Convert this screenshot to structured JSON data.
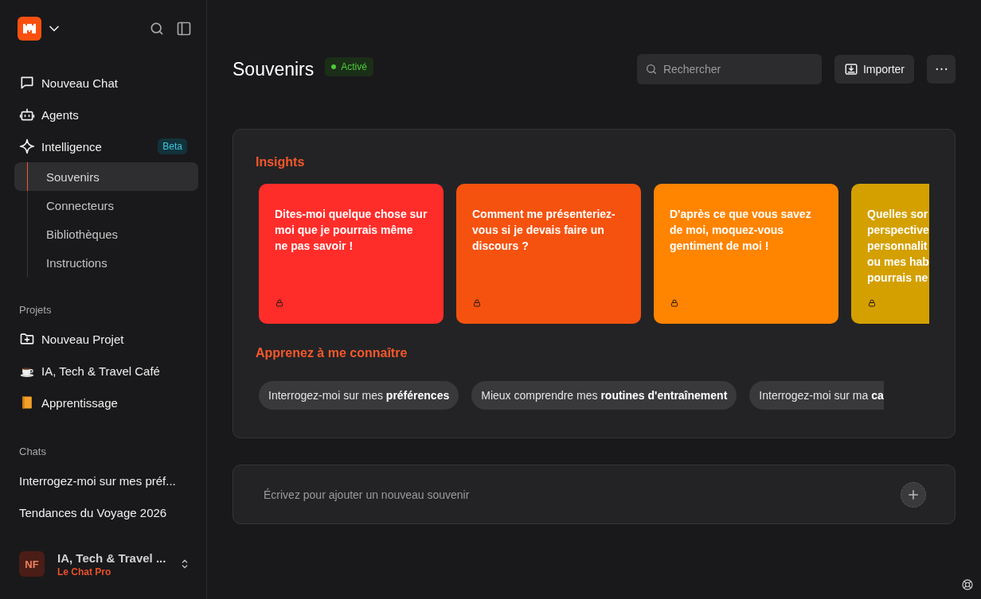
{
  "sidebar": {
    "nav": [
      {
        "label": "Nouveau Chat",
        "kind": "chat"
      },
      {
        "label": "Agents",
        "kind": "robot"
      },
      {
        "label": "Intelligence",
        "kind": "sparkle",
        "badge": "Beta",
        "children": [
          {
            "label": "Souvenirs",
            "selected": true
          },
          {
            "label": "Connecteurs",
            "selected": false
          },
          {
            "label": "Bibliothèques",
            "selected": false
          },
          {
            "label": "Instructions",
            "selected": false
          }
        ]
      }
    ],
    "projects": {
      "heading": "Projets",
      "items": [
        {
          "label": "Nouveau Projet",
          "kind": "new"
        },
        {
          "label": "IA, Tech & Travel Café",
          "kind": "coffee"
        },
        {
          "label": "Apprentissage",
          "kind": "book"
        }
      ]
    },
    "chats": {
      "heading": "Chats",
      "items": [
        "Interrogez-moi sur mes préf...",
        "Tendances du Voyage 2026"
      ]
    },
    "account": {
      "initials": "NF",
      "name": "IA, Tech & Travel ...",
      "plan": "Le Chat Pro"
    }
  },
  "header": {
    "title": "Souvenirs",
    "status": "Activé",
    "search": {
      "placeholder": "Rechercher"
    },
    "import_button": "Importer"
  },
  "insights": {
    "title": "Insights",
    "cards": [
      {
        "text": "Dites-moi quelque chose sur moi que je pourrais même ne pas savoir !",
        "color": "#ff2d2a"
      },
      {
        "text": "Comment me présenteriez-vous si je devais faire un discours ?",
        "color": "#f5520f"
      },
      {
        "text": "D'après ce que vous savez de moi, moquez-vous gentiment de moi !",
        "color": "#ff8400"
      },
      {
        "text": "Quelles sor\nperspective\npersonnalit\nou mes hab\npourrais ne",
        "color": "#d4a000"
      }
    ],
    "learn_title": "Apprenez à me connaître",
    "chips": [
      "Interrogez-moi sur mes **préférences**",
      "Mieux comprendre mes **routines d'entraînement**",
      "Interrogez-moi sur ma **ca**"
    ]
  },
  "composer": {
    "placeholder": "Écrivez pour ajouter un nouveau souvenir"
  }
}
